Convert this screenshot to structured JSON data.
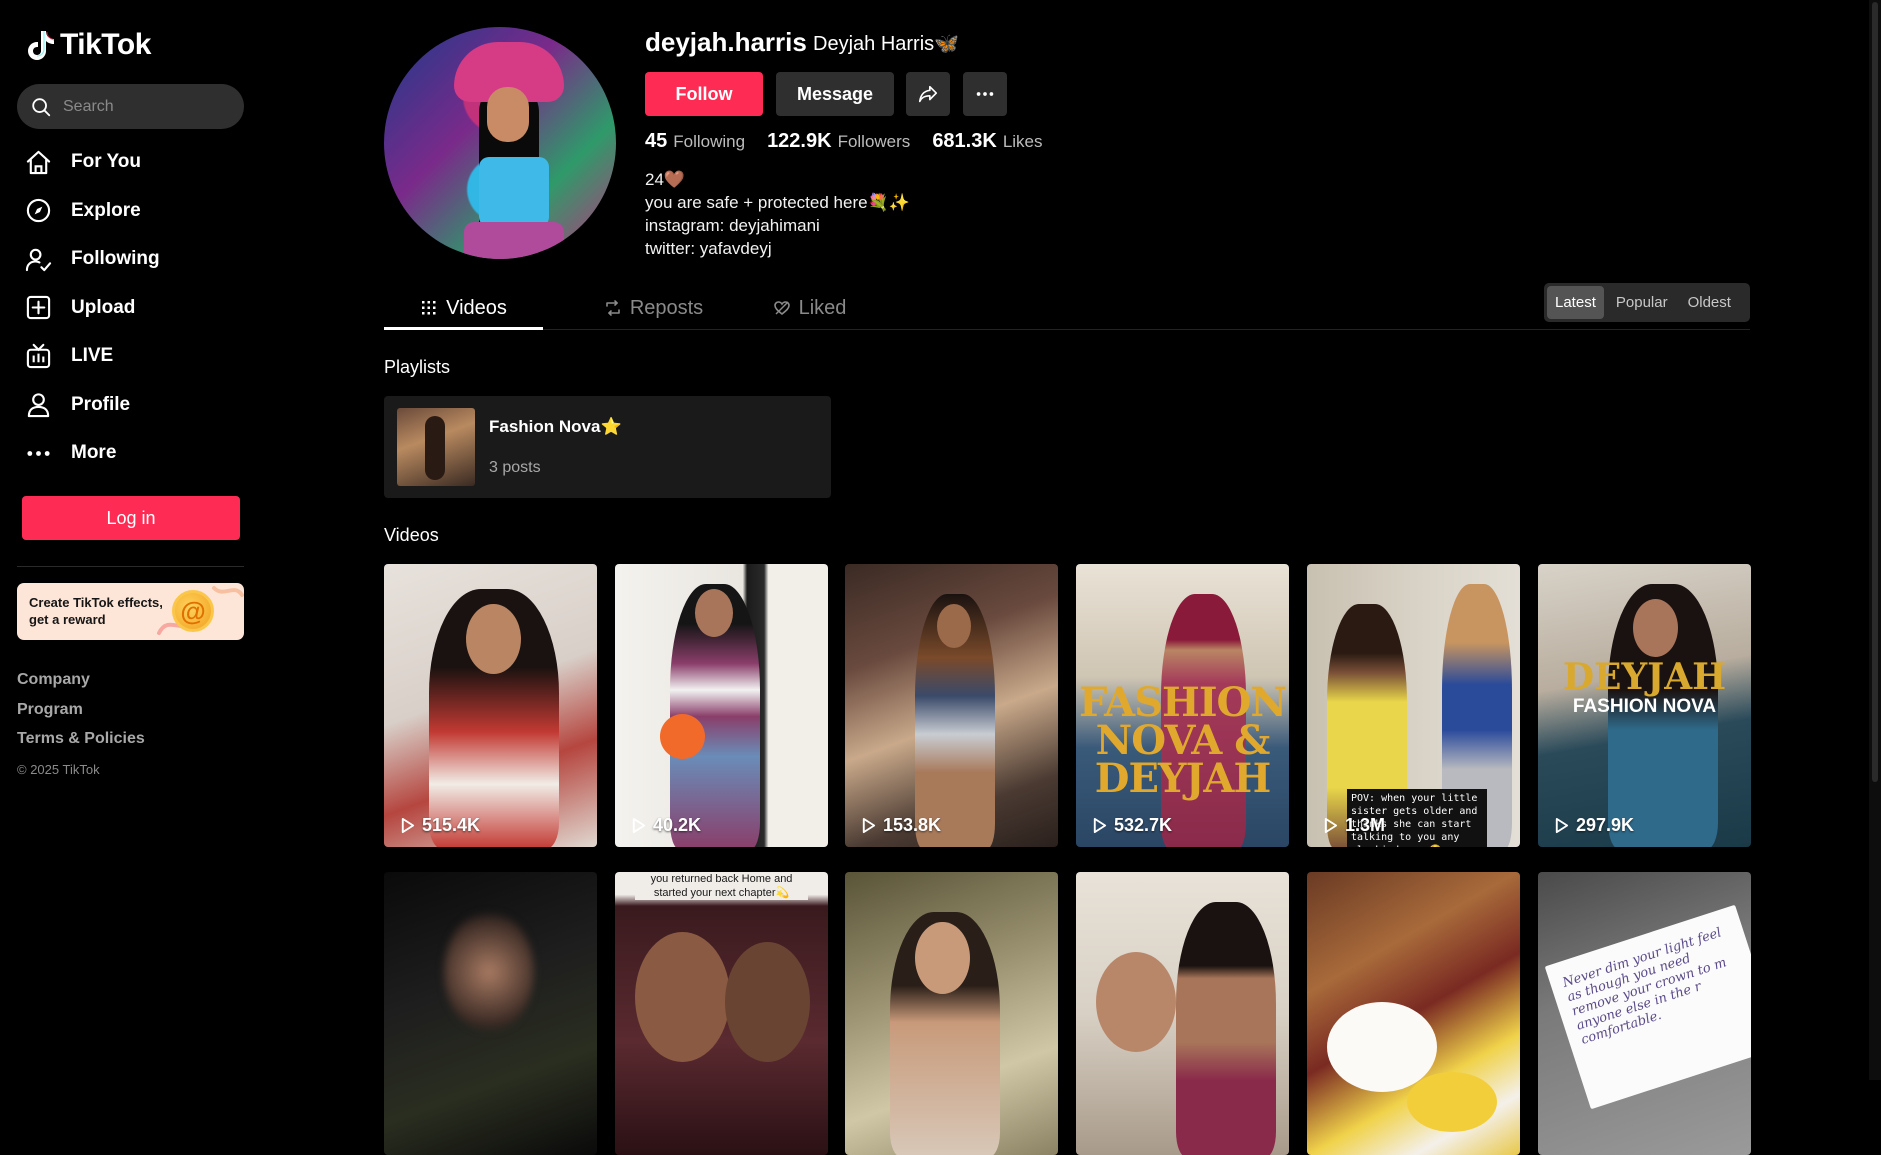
{
  "app": {
    "brand": "TikTok"
  },
  "search": {
    "placeholder": "Search"
  },
  "nav": [
    {
      "label": "For You",
      "icon": "home-icon"
    },
    {
      "label": "Explore",
      "icon": "compass-icon"
    },
    {
      "label": "Following",
      "icon": "following-icon"
    },
    {
      "label": "Upload",
      "icon": "upload-icon"
    },
    {
      "label": "LIVE",
      "icon": "live-icon"
    },
    {
      "label": "Profile",
      "icon": "profile-icon"
    },
    {
      "label": "More",
      "icon": "more-icon"
    }
  ],
  "login": {
    "label": "Log in"
  },
  "promo": {
    "line1": "Create TikTok effects,",
    "line2": "get a reward"
  },
  "footer": {
    "company": "Company",
    "program": "Program",
    "terms": "Terms & Policies",
    "copyright": "© 2025 TikTok"
  },
  "profile": {
    "username": "deyjah.harris",
    "display_name": "Deyjah Harris🦋",
    "follow_label": "Follow",
    "message_label": "Message",
    "stats": {
      "following_count": "45",
      "following_label": "Following",
      "followers_count": "122.9K",
      "followers_label": "Followers",
      "likes_count": "681.3K",
      "likes_label": "Likes"
    },
    "bio": [
      "24🤎",
      "you are safe + protected here💐✨",
      "instagram: deyjahimani",
      "twitter: yafavdeyj"
    ]
  },
  "tabs": {
    "videos": "Videos",
    "reposts": "Reposts",
    "liked": "Liked"
  },
  "sort": {
    "latest": "Latest",
    "popular": "Popular",
    "oldest": "Oldest",
    "selected": "Latest"
  },
  "playlists": {
    "heading": "Playlists",
    "items": [
      {
        "title": "Fashion Nova⭐",
        "count": "3 posts"
      }
    ]
  },
  "videos": {
    "heading": "Videos",
    "row1": [
      {
        "views": "515.4K"
      },
      {
        "views": "40.2K"
      },
      {
        "views": "153.8K"
      },
      {
        "views": "532.7K",
        "overlay": "FASHION NOVA & DEYJAH"
      },
      {
        "views": "1.3M",
        "overlay": "POV: when your little sister gets older and thinks she can start talking to you any ole kinda way😳"
      },
      {
        "views": "297.9K",
        "overlay": "FASHION NOVA"
      }
    ],
    "row2": [
      {
        "overlay": ""
      },
      {
        "overlay": "you returned back Home and started your next chapter💫"
      },
      {
        "overlay": ""
      },
      {
        "overlay": ""
      },
      {
        "overlay": ""
      },
      {
        "overlay": "Never dim your light feel as though you need remove your crown to m anyone else in the r comfortable."
      }
    ]
  }
}
